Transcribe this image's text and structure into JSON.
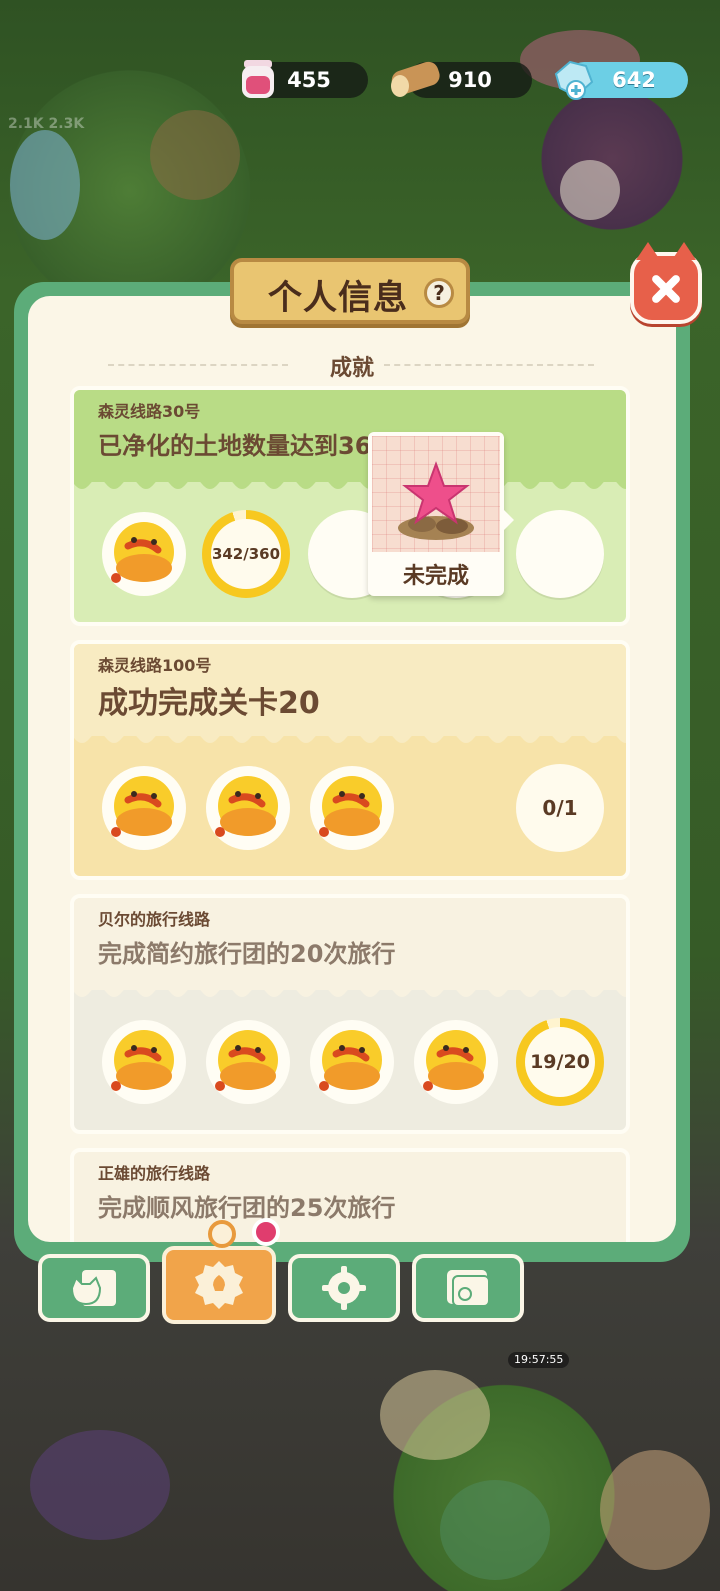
{
  "resources": [
    {
      "name": "juice",
      "value": "455",
      "icon": "juice-jar-icon",
      "color": "#e0507a"
    },
    {
      "name": "wood",
      "value": "910",
      "icon": "wood-log-icon",
      "color": "#c99456"
    },
    {
      "name": "gem",
      "value": "642",
      "icon": "gem-icon",
      "color": "#6ccfe5"
    }
  ],
  "panel": {
    "title": "个人信息",
    "help_label": "?",
    "section_title": "成就"
  },
  "achievements": [
    {
      "route": "森灵线路30号",
      "description": "已净化的土地数量达到360块",
      "progress": "342/360",
      "progress_fraction": 0.95
    },
    {
      "route": "森灵线路100号",
      "description": "成功完成关卡20",
      "progress": "0/1",
      "progress_fraction": 0
    },
    {
      "route": "贝尔的旅行线路",
      "description": "完成简约旅行团的20次旅行",
      "progress": "19/20",
      "progress_fraction": 0.95
    },
    {
      "route": "正雄的旅行线路",
      "description": "完成顺风旅行团的25次旅行"
    }
  ],
  "tooltip": {
    "status": "未完成",
    "icon": "pink-star-reward-icon"
  },
  "tabs": [
    {
      "name": "profile",
      "icon": "cat-card-icon",
      "active": false
    },
    {
      "name": "achievements",
      "icon": "medal-icon",
      "active": true
    },
    {
      "name": "settings",
      "icon": "gear-icon",
      "active": false
    },
    {
      "name": "album",
      "icon": "photo-folder-icon",
      "active": false
    }
  ],
  "background": {
    "timer": "19:57:55",
    "faint_label": "2.1K 2.3K"
  }
}
